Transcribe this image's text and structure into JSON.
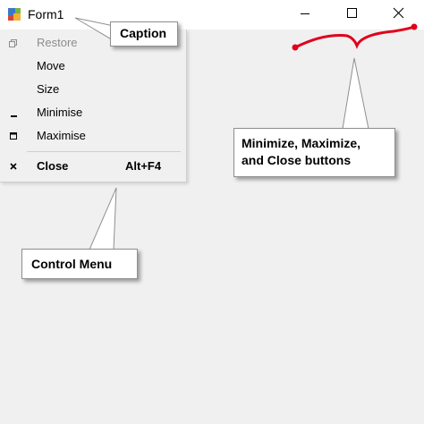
{
  "window": {
    "title": "Form1",
    "icon": "winforms-app-icon",
    "controls": {
      "minimize_icon": "minimize-icon",
      "maximize_icon": "maximize-icon",
      "close_icon": "close-icon"
    }
  },
  "system_menu": {
    "items": [
      {
        "label": "Restore",
        "icon": "restore-icon",
        "state": "disabled"
      },
      {
        "label": "Move"
      },
      {
        "label": "Size"
      },
      {
        "label": "Minimise",
        "icon": "minimize-icon"
      },
      {
        "label": "Maximise",
        "icon": "maximize-icon"
      },
      {
        "label": "Close",
        "icon": "close-icon",
        "shortcut": "Alt+F4",
        "style": "bold"
      }
    ]
  },
  "annotations": {
    "caption": "Caption",
    "control_menu": "Control Menu",
    "buttons_line1": "Minimize, Maximize,",
    "buttons_line2": "and Close buttons"
  },
  "colors": {
    "title_bar": "#ffffff",
    "client_area": "#f0f0f0",
    "annotation_mark": "#e0001b",
    "disabled_text": "#8d8d8d"
  }
}
